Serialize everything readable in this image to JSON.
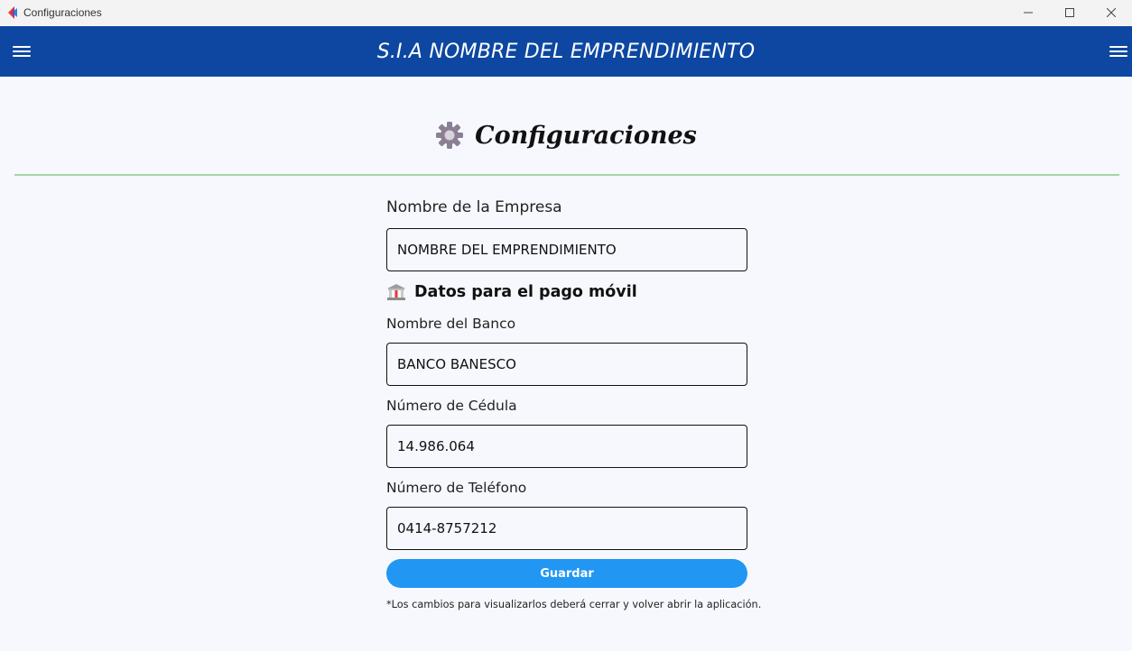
{
  "window": {
    "title": "Configuraciones",
    "controls": [
      "minimize",
      "maximize",
      "close"
    ]
  },
  "appbar": {
    "title": "S.I.A NOMBRE DEL EMPRENDIMIENTO",
    "color": "#0d47a1",
    "left_icon": "menu-icon",
    "right_icon": "menu-icon"
  },
  "page": {
    "title": "Configuraciones",
    "title_icon": "gear-icon",
    "divider_color": "#a5d6a7"
  },
  "form": {
    "company_label": "Nombre de la Empresa",
    "company_value": "NOMBRE DEL EMPRENDIMIENTO",
    "section_title": "Datos para el pago móvil",
    "section_icon": "bank-icon",
    "bank_label": "Nombre del Banco",
    "bank_value": "BANCO BANESCO",
    "id_label": "Número de Cédula",
    "id_value": "14.986.064",
    "phone_label": "Número de Teléfono",
    "phone_value": "0414-8757212",
    "save_label": "Guardar",
    "save_color": "#2196f3",
    "note": "*Los cambios para visualizarlos deberá cerrar y volver abrir la aplicación."
  }
}
